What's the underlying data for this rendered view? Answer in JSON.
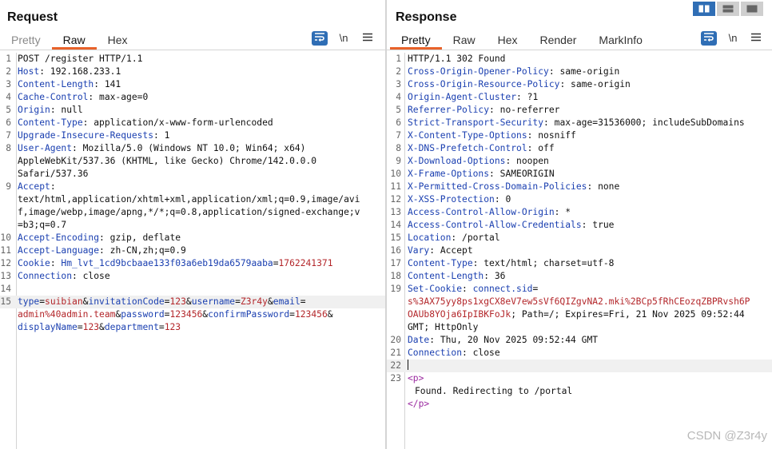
{
  "request": {
    "title": "Request",
    "tabs": [
      {
        "label": "Pretty",
        "active": false
      },
      {
        "label": "Raw",
        "active": true
      },
      {
        "label": "Hex",
        "active": false
      }
    ],
    "tools": {
      "newline_label": "\\n"
    },
    "lines": [
      {
        "n": "1",
        "text": "POST /register HTTP/1.1"
      },
      {
        "n": "2",
        "key": "Host",
        "sep": ": ",
        "value": "192.168.233.1"
      },
      {
        "n": "3",
        "key": "Content-Length",
        "sep": ": ",
        "value": "141"
      },
      {
        "n": "4",
        "key": "Cache-Control",
        "sep": ": ",
        "value": "max-age=0"
      },
      {
        "n": "5",
        "key": "Origin",
        "sep": ": ",
        "value": "null"
      },
      {
        "n": "6",
        "key": "Content-Type",
        "sep": ": ",
        "value": "application/x-www-form-urlencoded"
      },
      {
        "n": "7",
        "key": "Upgrade-Insecure-Requests",
        "sep": ": ",
        "value": "1"
      },
      {
        "n": "8",
        "key": "User-Agent",
        "sep": ": ",
        "value": "Mozilla/5.0 (Windows NT 10.0; Win64; x64)"
      },
      {
        "n": "",
        "value": "AppleWebKit/537.36 (KHTML, like Gecko) Chrome/142.0.0.0"
      },
      {
        "n": "",
        "value": "Safari/537.36"
      },
      {
        "n": "9",
        "key": "Accept",
        "sep": ":"
      },
      {
        "n": "",
        "value": "text/html,application/xhtml+xml,application/xml;q=0.9,image/avi"
      },
      {
        "n": "",
        "value": "f,image/webp,image/apng,*/*;q=0.8,application/signed-exchange;v"
      },
      {
        "n": "",
        "value": "=b3;q=0.7"
      },
      {
        "n": "10",
        "key": "Accept-Encoding",
        "sep": ": ",
        "value": "gzip, deflate"
      },
      {
        "n": "11",
        "key": "Accept-Language",
        "sep": ": ",
        "value": "zh-CN,zh;q=0.9"
      },
      {
        "n": "12",
        "key": "Cookie",
        "sep": ": ",
        "cookie_name": "Hm_lvt_1cd9bcbaae133f03a6eb19da6579aaba",
        "cookie_eq": "=",
        "cookie_val": "1762241371"
      },
      {
        "n": "13",
        "key": "Connection",
        "sep": ": ",
        "value": "close"
      },
      {
        "n": "14",
        "text": ""
      },
      {
        "n": "15",
        "highlight": true,
        "params": [
          {
            "k": "type",
            "eq": "=",
            "v": "suibian",
            "amp": "&"
          },
          {
            "k": "invitationCode",
            "eq": "=",
            "v": "123",
            "amp": "&"
          },
          {
            "k": "username",
            "eq": "=",
            "v": "Z3r4y",
            "amp": "&"
          },
          {
            "k": "email",
            "eq": "=",
            "v": "",
            "amp": ""
          }
        ]
      },
      {
        "n": "",
        "params": [
          {
            "k": "",
            "eq": "",
            "v": "admin%40admin.team",
            "amp": "&"
          },
          {
            "k": "password",
            "eq": "=",
            "v": "123456",
            "amp": "&"
          },
          {
            "k": "confirmPassword",
            "eq": "=",
            "v": "123456",
            "amp": "&"
          }
        ]
      },
      {
        "n": "",
        "params": [
          {
            "k": "displayName",
            "eq": "=",
            "v": "123",
            "amp": "&"
          },
          {
            "k": "department",
            "eq": "=",
            "v": "123",
            "amp": ""
          }
        ]
      }
    ]
  },
  "response": {
    "title": "Response",
    "tabs": [
      {
        "label": "Pretty",
        "active": true
      },
      {
        "label": "Raw",
        "active": false
      },
      {
        "label": "Hex",
        "active": false
      },
      {
        "label": "Render",
        "active": false
      },
      {
        "label": "MarkInfo",
        "active": false
      }
    ],
    "tools": {
      "newline_label": "\\n"
    },
    "lines": [
      {
        "n": "1",
        "text": "HTTP/1.1 302 Found"
      },
      {
        "n": "2",
        "key": "Cross-Origin-Opener-Policy",
        "sep": ": ",
        "value": "same-origin"
      },
      {
        "n": "3",
        "key": "Cross-Origin-Resource-Policy",
        "sep": ": ",
        "value": "same-origin"
      },
      {
        "n": "4",
        "key": "Origin-Agent-Cluster",
        "sep": ": ",
        "value": "?1"
      },
      {
        "n": "5",
        "key": "Referrer-Policy",
        "sep": ": ",
        "value": "no-referrer"
      },
      {
        "n": "6",
        "key": "Strict-Transport-Security",
        "sep": ": ",
        "value": "max-age=31536000; includeSubDomains"
      },
      {
        "n": "7",
        "key": "X-Content-Type-Options",
        "sep": ": ",
        "value": "nosniff"
      },
      {
        "n": "8",
        "key": "X-DNS-Prefetch-Control",
        "sep": ": ",
        "value": "off"
      },
      {
        "n": "9",
        "key": "X-Download-Options",
        "sep": ": ",
        "value": "noopen"
      },
      {
        "n": "10",
        "key": "X-Frame-Options",
        "sep": ": ",
        "value": "SAMEORIGIN"
      },
      {
        "n": "11",
        "key": "X-Permitted-Cross-Domain-Policies",
        "sep": ": ",
        "value": "none"
      },
      {
        "n": "12",
        "key": "X-XSS-Protection",
        "sep": ": ",
        "value": "0"
      },
      {
        "n": "13",
        "key": "Access-Control-Allow-Origin",
        "sep": ": ",
        "value": "*"
      },
      {
        "n": "14",
        "key": "Access-Control-Allow-Credentials",
        "sep": ": ",
        "value": "true"
      },
      {
        "n": "15",
        "key": "Location",
        "sep": ": ",
        "value": "/portal"
      },
      {
        "n": "16",
        "key": "Vary",
        "sep": ": ",
        "value": "Accept"
      },
      {
        "n": "17",
        "key": "Content-Type",
        "sep": ": ",
        "value": "text/html; charset=utf-8"
      },
      {
        "n": "18",
        "key": "Content-Length",
        "sep": ": ",
        "value": "36"
      },
      {
        "n": "19",
        "key": "Set-Cookie",
        "sep": ": ",
        "cookie_name": "connect.sid",
        "cookie_eq": "="
      },
      {
        "n": "",
        "cookie_val": "s%3AX75yy8ps1xgCX8eV7ew5sVf6QIZgvNA2.mki%2BCp5fRhCEozqZBPRvsh6P"
      },
      {
        "n": "",
        "cookie_val": "OAUb8YOja6IpIBKFoJk",
        "value": "; Path=/; Expires=Fri, 21 Nov 2025 09:52:44"
      },
      {
        "n": "",
        "value": "GMT; HttpOnly"
      },
      {
        "n": "20",
        "key": "Date",
        "sep": ": ",
        "value": "Thu, 20 Nov 2025 09:52:44 GMT"
      },
      {
        "n": "21",
        "key": "Connection",
        "sep": ": ",
        "value": "close"
      },
      {
        "n": "22",
        "highlight": true,
        "caret": true,
        "text": ""
      },
      {
        "n": "23",
        "tag": "<p>"
      },
      {
        "n": "",
        "indent": true,
        "text": "Found. Redirecting to /portal"
      },
      {
        "n": "",
        "tag": "</p>"
      }
    ]
  },
  "watermark": "CSDN @Z3r4y",
  "colors": {
    "accent": "#e8622a",
    "header_key": "#1a3fb0",
    "param_value": "#b3262a",
    "tag": "#9b2aa0",
    "toolbar_blue": "#2f6eb5"
  },
  "icons": [
    "word-wrap-icon",
    "newline-icon",
    "hamburger-menu-icon",
    "layout-side-by-side-icon",
    "layout-stacked-icon",
    "layout-single-icon"
  ]
}
